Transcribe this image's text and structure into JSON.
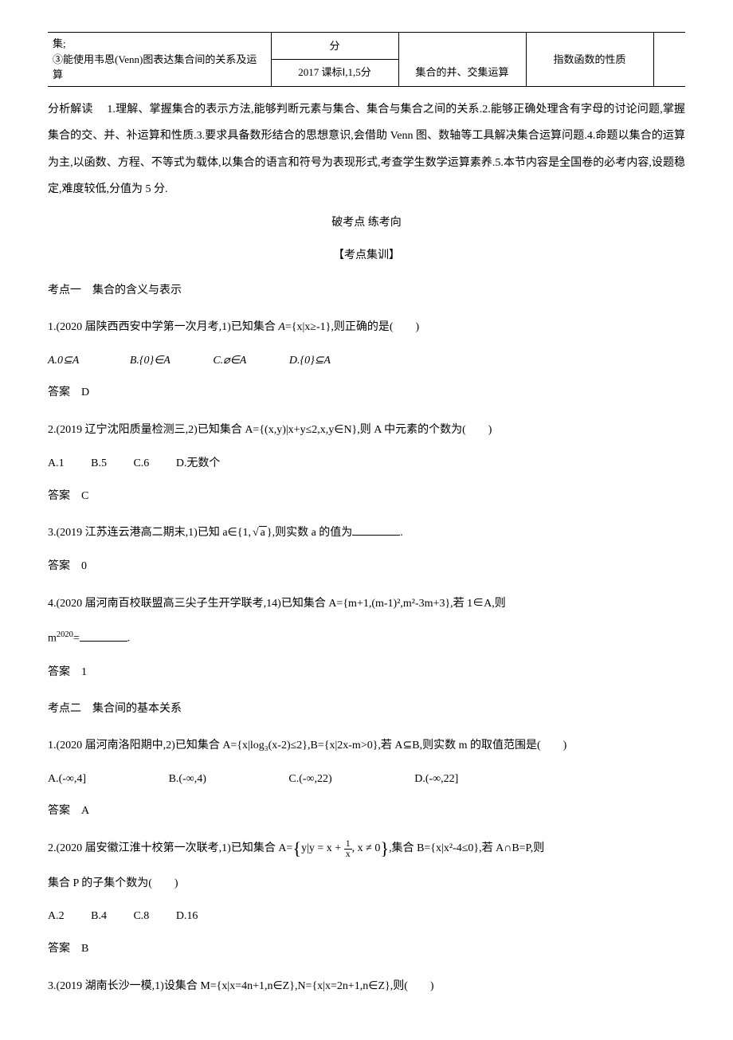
{
  "table": {
    "r1c1": "集;",
    "r1c2": "分",
    "r2c1": "③能使用韦恩(Venn)图表达集合间的关系及运算",
    "r2c2": "2017 课标Ⅰ,1,5分",
    "r2c3": "集合的并、交集运算",
    "r2c4": "指数函数的性质"
  },
  "analysis_label": "分析解读",
  "analysis_body": "　1.理解、掌握集合的表示方法,能够判断元素与集合、集合与集合之间的关系.2.能够正确处理含有字母的讨论问题,掌握集合的交、并、补运算和性质.3.要求具备数形结合的思想意识,会借助 Venn 图、数轴等工具解决集合运算问题.4.命题以集合的运算为主,以函数、方程、不等式为载体,以集合的语言和符号为表现形式,考查学生数学运算素养.5.本节内容是全国卷的必考内容,设题稳定,难度较低,分值为 5 分.",
  "heading1": "破考点 练考向",
  "heading2": "【考点集训】",
  "topic1": "考点一　集合的含义与表示",
  "q1_stem_a": "1.(2020 届陕西西安中学第一次月考,1)已知集合 ",
  "q1_set": "A",
  "q1_stem_b": "={x|x≥-1},则正确的是(　　)",
  "q1_opts": {
    "A": "A.0⊆A",
    "B": "B.{0}∈A",
    "C": "C.⌀∈A",
    "D": "D.{0}⊆A"
  },
  "q1_ans": "答案　D",
  "q2_stem": "2.(2019 辽宁沈阳质量检测三,2)已知集合 A={(x,y)|x+y≤2,x,y∈N},则 A 中元素的个数为(　　)",
  "q2_opts": {
    "A": "A.1",
    "B": "B.5",
    "C": "C.6",
    "D": "D.无数个"
  },
  "q2_ans": "答案　C",
  "q3_stem_a": "3.(2019 江苏连云港高二期末,1)已知 a∈{1,",
  "q3_sqrt": "a",
  "q3_stem_b": "},则实数 a 的值为",
  "q3_tail": ".",
  "q3_ans": "答案　0",
  "q4_stem": "4.(2020 届河南百校联盟高三尖子生开学联考,14)已知集合 A={m+1,(m-1)²,m²-3m+3},若 1∈A,则",
  "q4_line2a": "m",
  "q4_exp": "2020",
  "q4_line2b": "=",
  "q4_tail": ".",
  "q4_ans": "答案　1",
  "topic2": "考点二　集合间的基本关系",
  "p2q1_stem": "1.(2020 届河南洛阳期中,2)已知集合 A={x|log₃(x-2)≤2},B={x|2x-m>0},若 A⊆B,则实数 m 的取值范围是(　　)",
  "p2q1_opts": {
    "A": "A.(-∞,4]",
    "B": "B.(-∞,4)",
    "C": "C.(-∞,22)",
    "D": "D.(-∞,22]"
  },
  "p2q1_ans": "答案　A",
  "p2q2_stem_a": "2.(2020 届安徽江淮十校第一次联考,1)已知集合 A=",
  "p2q2_inner_a": "y|y = x + ",
  "p2q2_frac_n": "1",
  "p2q2_frac_d": "x",
  "p2q2_inner_b": ", x ≠ 0",
  "p2q2_stem_b": ",集合 B={x|x²-4≤0},若 A∩B=P,则",
  "p2q2_line2": "集合 P 的子集个数为(　　)",
  "p2q2_opts": {
    "A": "A.2",
    "B": "B.4",
    "C": "C.8",
    "D": "D.16"
  },
  "p2q2_ans": "答案　B",
  "p2q3_stem": "3.(2019 湖南长沙一模,1)设集合 M={x|x=4n+1,n∈Z},N={x|x=2n+1,n∈Z},则(　　)"
}
